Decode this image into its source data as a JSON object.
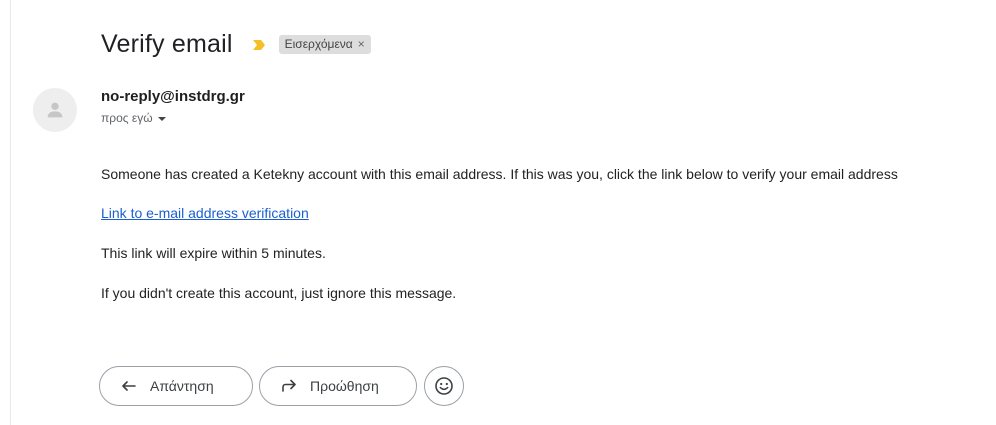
{
  "email": {
    "subject": "Verify email",
    "label": "Εισερχόμενα",
    "label_remove": "×",
    "sender": "no-reply@instdrg.gr",
    "recipient": "προς εγώ",
    "body": {
      "paragraph1": "Someone has created a Ketekny account with this email address. If this was you, click the link below to verify your email address",
      "link_text": "Link to e-mail address verification",
      "paragraph2": "This link will expire within 5 minutes.",
      "paragraph3": "If you didn't create this account, just ignore this message."
    }
  },
  "actions": {
    "reply_label": "Απάντηση",
    "forward_label": "Προώθηση"
  },
  "icons": {
    "importance": "importance-marker-icon",
    "avatar": "person-icon",
    "reply": "reply-arrow-icon",
    "forward": "forward-arrow-icon",
    "emoji": "smiley-icon",
    "recipient_dropdown": "caret-down-icon"
  },
  "colors": {
    "importance": "#f6bf26",
    "link": "#1a5fd1",
    "label_chip": "#dddddd"
  }
}
